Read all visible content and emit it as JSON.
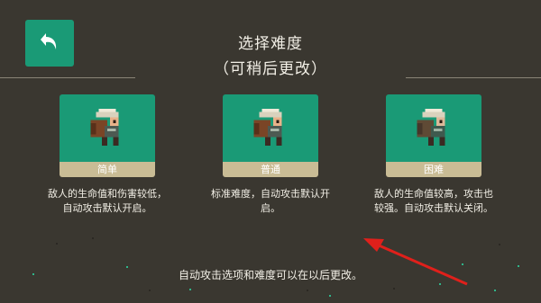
{
  "header": {
    "title": "选择难度",
    "subtitle": "（可稍后更改）",
    "back_icon": "return-arrow-icon"
  },
  "cards": [
    {
      "label": "简单",
      "description": "敌人的生命值和伤害较低，自动攻击默认开启。"
    },
    {
      "label": "普通",
      "description": "标准难度，自动攻击默认开启。"
    },
    {
      "label": "困难",
      "description": "敌人的生命值较高，攻击也较强。自动攻击默认关闭。"
    }
  ],
  "footer": {
    "note": "自动攻击选项和难度可以在以后更改。"
  },
  "colors": {
    "background": "#3a3730",
    "card_green": "#1a9a76",
    "label_tan": "#c9bc95",
    "annotation_red": "#e0201b"
  }
}
